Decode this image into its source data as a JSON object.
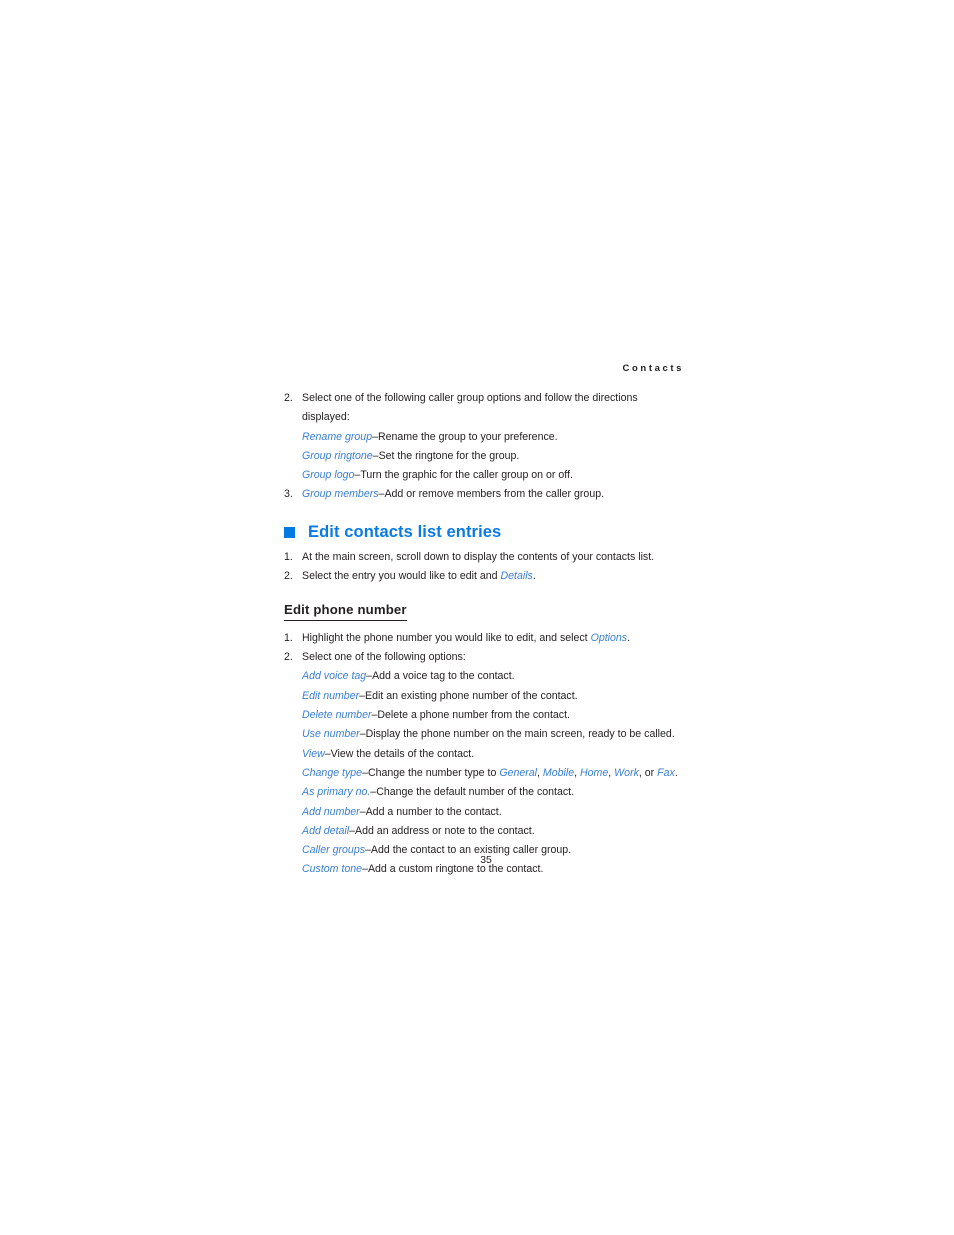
{
  "header": {
    "running_head": "Contacts"
  },
  "page_number": "35",
  "colors": {
    "heading_blue": "#0a7ae4",
    "bullet_square": "#0479e2",
    "term_blue": "#3b7fd4",
    "body_text": "#231f20"
  },
  "caller_group_section": {
    "step2": {
      "number": "2.",
      "text": "Select one of the following caller group options and follow the directions displayed:"
    },
    "options": [
      {
        "term": "Rename group",
        "desc": "–Rename the group to your preference."
      },
      {
        "term": "Group ringtone",
        "desc": "–Set the ringtone for the group."
      },
      {
        "term": "Group logo",
        "desc": "–Turn the graphic for the caller group on or off."
      }
    ],
    "step3": {
      "number": "3.",
      "term": "Group members",
      "desc": "–Add or remove members from the caller group."
    }
  },
  "edit_contacts_section": {
    "heading": "Edit contacts list entries",
    "bullet_icon": "blue-square-icon",
    "steps": [
      {
        "number": "1.",
        "text": "At the main screen, scroll down to display the contents of your contacts list."
      },
      {
        "number": "2.",
        "text_before": "Select the entry you would like to edit and ",
        "term": "Details",
        "text_after": "."
      }
    ]
  },
  "edit_phone_number_section": {
    "heading": "Edit phone number",
    "step1": {
      "number": "1.",
      "text_before": "Highlight the phone number you would like to edit, and select ",
      "term": "Options",
      "text_after": "."
    },
    "step2": {
      "number": "2.",
      "text": "Select one of the following options:"
    },
    "options": [
      {
        "term": "Add voice tag",
        "desc": "–Add a voice tag to the contact."
      },
      {
        "term": "Edit number",
        "desc": "–Edit an existing phone number of the contact."
      },
      {
        "term": "Delete number",
        "desc": "–Delete a phone number from the contact."
      },
      {
        "term": "Use number",
        "desc": "–Display the phone number on the main screen, ready to be called."
      },
      {
        "term": "View",
        "desc": "–View the details of the contact."
      }
    ],
    "change_type": {
      "term": "Change type",
      "desc_before": "–Change the number type to ",
      "types": [
        "General",
        "Mobile",
        "Home",
        "Work",
        "Fax"
      ],
      "sep": ", ",
      "last_sep": ", or ",
      "desc_after": "."
    },
    "options_tail": [
      {
        "term": "As primary no.",
        "desc": "–Change the default number of the contact."
      },
      {
        "term": "Add number",
        "desc": "–Add a number to the contact."
      },
      {
        "term": "Add detail",
        "desc": "–Add an address or note to the contact."
      },
      {
        "term": "Caller groups",
        "desc": "–Add the contact to an existing caller group."
      },
      {
        "term": "Custom tone",
        "desc": "–Add a custom ringtone to the contact."
      }
    ]
  }
}
